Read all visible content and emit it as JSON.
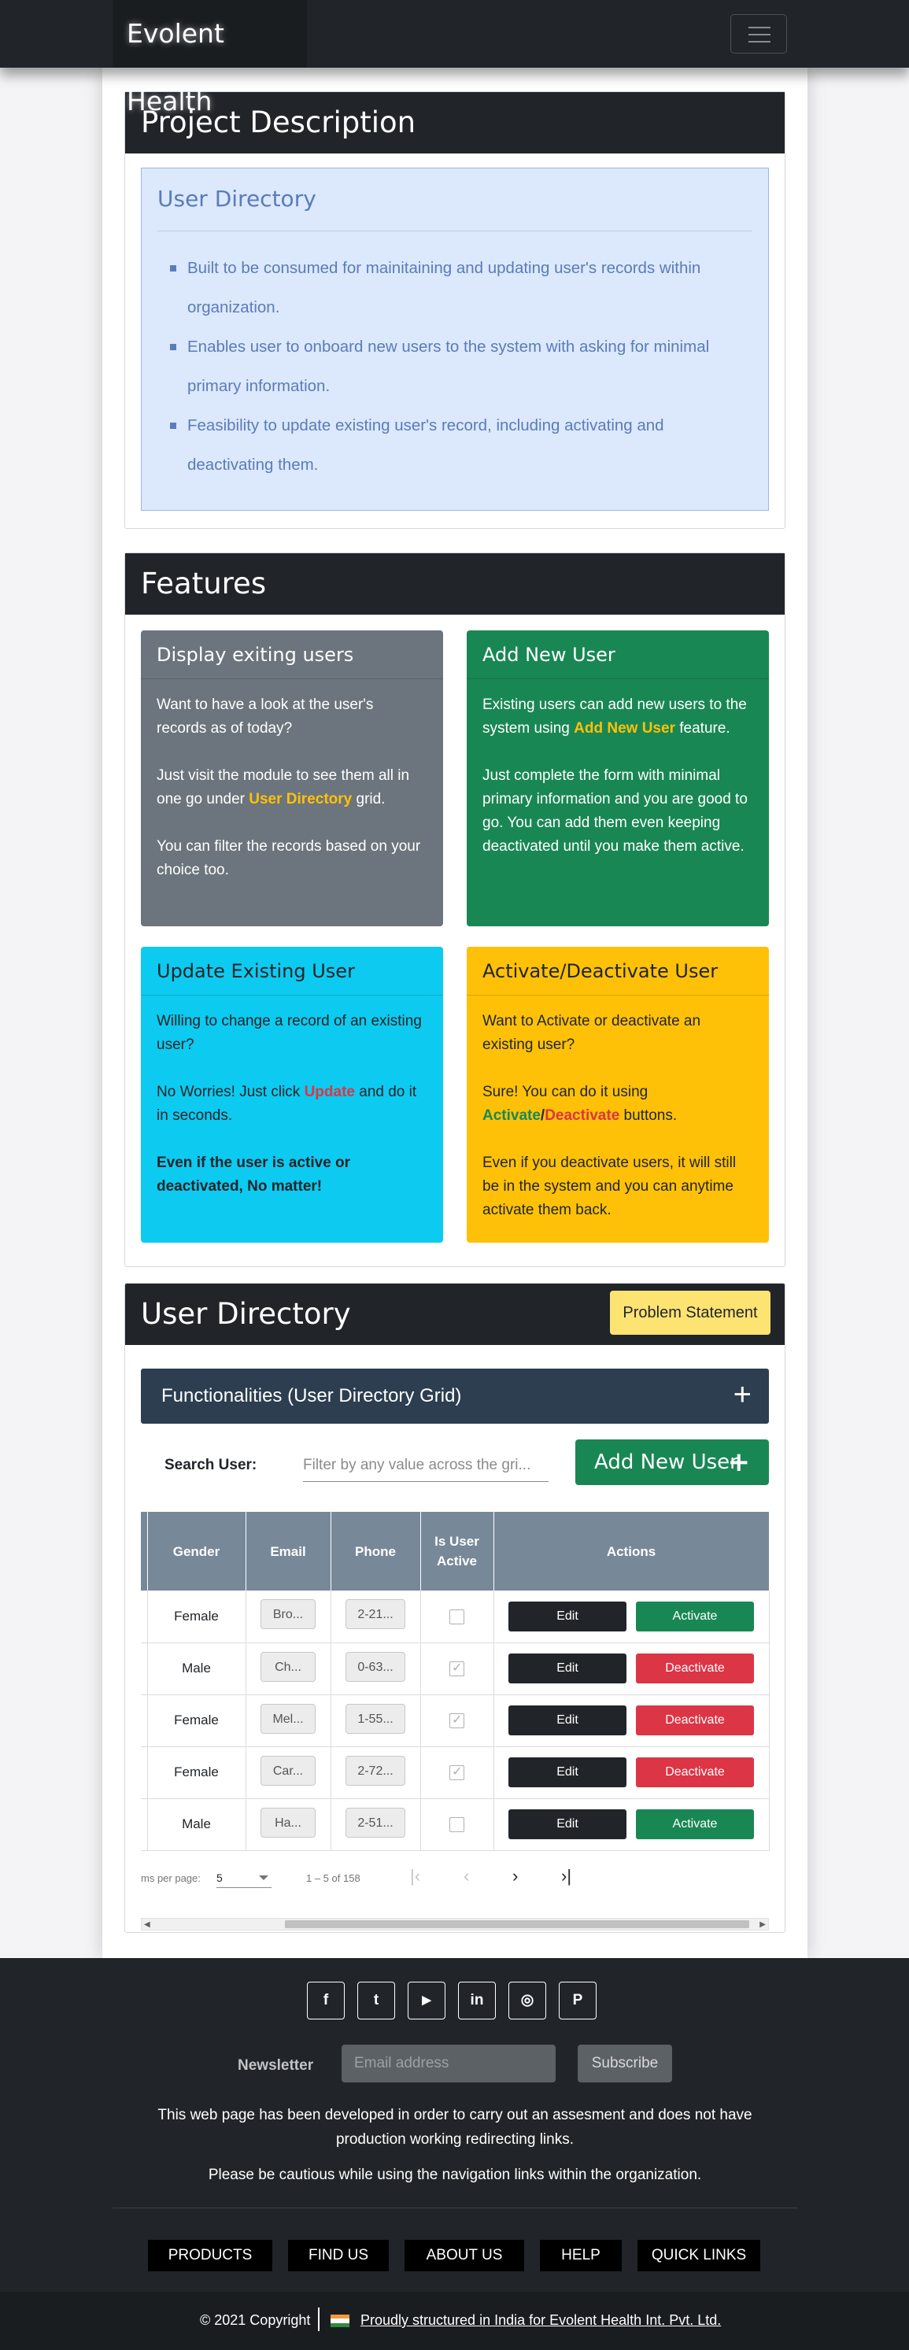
{
  "navbar": {
    "brand": "Evolent Health"
  },
  "project": {
    "header": "Project Description",
    "box_title": "User Directory",
    "bullets": [
      "Built to be consumed for mainitaining and updating user's records within organization.",
      "Enables user to onboard new users to the system with asking for minimal primary information.",
      "Feasibility to update existing user's record, including activating and deactivating them."
    ]
  },
  "features": {
    "header": "Features",
    "display": {
      "title": "Display exiting users",
      "p1": "Want to have a look at the user's records as of today?",
      "p2_pre": "Just visit the module to see them all in one go under ",
      "p2_hl": "User Directory",
      "p2_post": " grid.",
      "p3": "You can filter the records based on your choice too."
    },
    "add": {
      "title": "Add New User",
      "p1_pre": "Existing users can add new users to the system using ",
      "p1_hl": "Add New User",
      "p1_post": " feature.",
      "p2": "Just complete the form with minimal primary information and you are good to go. You can add them even keeping deactivated until you make them active."
    },
    "update": {
      "title": "Update Existing User",
      "p1": "Willing to change a record of an existing user?",
      "p2_pre": "No Worries! Just click ",
      "p2_hl": "Update",
      "p2_post": " and do it in seconds.",
      "p3": "Even if the user is active or deactivated, No matter!"
    },
    "activate": {
      "title": "Activate/Deactivate User",
      "p1": "Want to Activate or deactivate an existing user?",
      "p2_pre": "Sure! You can do it using ",
      "p2_hl_a": "Activate",
      "p2_slash": "/",
      "p2_hl_d": "Deactivate",
      "p2_post": " buttons.",
      "p3": "Even if you deactivate users, it will still be in the system and you can anytime activate them back."
    }
  },
  "directory": {
    "header": "User Directory",
    "problem_btn": "Problem Statement",
    "accordion": "Functionalities (User Directory Grid)",
    "accordion_icon": "+",
    "search_label": "Search User:",
    "search_placeholder": "Filter by any value across the gri...",
    "add_btn": "Add New User",
    "add_icon": "+",
    "columns": {
      "gender": "Gender",
      "email": "Email",
      "phone": "Phone",
      "active": "Is User Active",
      "actions": "Actions"
    },
    "rows": [
      {
        "gender": "Female",
        "email": "Bro...",
        "phone": "2-21...",
        "active": false,
        "edit": "Edit",
        "toggle": "Activate"
      },
      {
        "gender": "Male",
        "email": "Ch...",
        "phone": "0-63...",
        "active": true,
        "edit": "Edit",
        "toggle": "Deactivate"
      },
      {
        "gender": "Female",
        "email": "Mel...",
        "phone": "1-55...",
        "active": true,
        "edit": "Edit",
        "toggle": "Deactivate"
      },
      {
        "gender": "Female",
        "email": "Car...",
        "phone": "2-72...",
        "active": true,
        "edit": "Edit",
        "toggle": "Deactivate"
      },
      {
        "gender": "Male",
        "email": "Ha...",
        "phone": "2-51...",
        "active": false,
        "edit": "Edit",
        "toggle": "Activate"
      }
    ],
    "paginator": {
      "items_per_page": "ms per page:",
      "page_size": "5",
      "range": "1 – 5 of 158",
      "first": "|‹",
      "prev": "‹",
      "next": "›",
      "last": "›|"
    }
  },
  "footer": {
    "socials": [
      "f",
      "t",
      "▶",
      "in",
      "◎",
      "P"
    ],
    "newsletter_label": "Newsletter",
    "email_placeholder": "Email address",
    "subscribe": "Subscribe",
    "note1": "This web page has been developed in order to carry out an assesment and does not have production working redirecting links.",
    "note2": "Please be cautious while using the navigation links within the organization.",
    "links": [
      "PRODUCTS",
      "FIND US",
      "ABOUT US",
      "HELP",
      "QUICK LINKS"
    ],
    "copyright": "© 2021 Copyright",
    "credit": "Proudly structured in India for Evolent Health Int. Pvt. Ltd."
  }
}
